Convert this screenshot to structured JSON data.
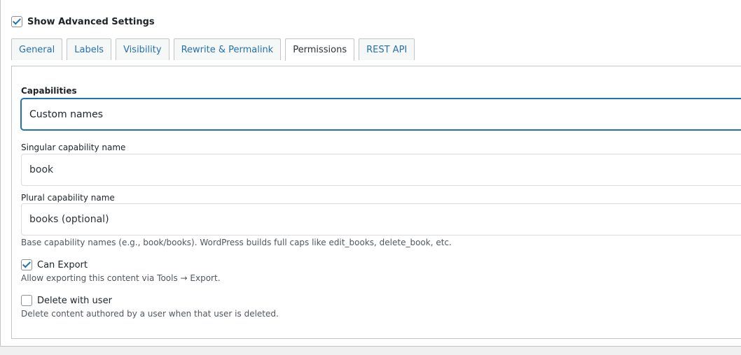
{
  "advanced": {
    "label": "Show Advanced Settings",
    "checked": true
  },
  "tabs": [
    {
      "label": "General",
      "active": false
    },
    {
      "label": "Labels",
      "active": false
    },
    {
      "label": "Visibility",
      "active": false
    },
    {
      "label": "Rewrite & Permalink",
      "active": false
    },
    {
      "label": "Permissions",
      "active": true
    },
    {
      "label": "REST API",
      "active": false
    }
  ],
  "capabilities": {
    "label": "Capabilities",
    "value": "Custom names"
  },
  "singular": {
    "label": "Singular capability name",
    "value": "book"
  },
  "plural": {
    "label": "Plural capability name",
    "value": "books (optional)"
  },
  "caps_description": "Base capability names (e.g., book/books). WordPress builds full caps like edit_books, delete_book, etc.",
  "can_export": {
    "label": "Can Export",
    "checked": true,
    "description": "Allow exporting this content via Tools → Export."
  },
  "delete_with_user": {
    "label": "Delete with user",
    "checked": false,
    "description": "Delete content authored by a user when that user is deleted."
  }
}
